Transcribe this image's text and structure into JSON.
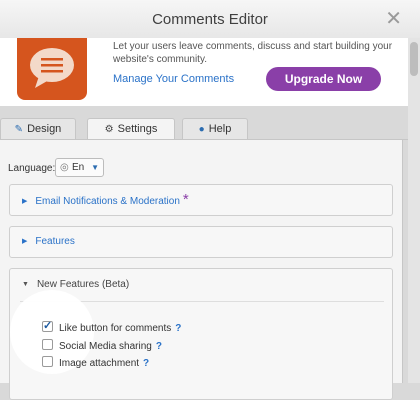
{
  "header": {
    "title": "Comments Editor",
    "close_glyph": "✕"
  },
  "promo": {
    "description": "Let your users leave comments, discuss and start building your website's community.",
    "manage_link": "Manage Your Comments",
    "upgrade_button": "Upgrade Now",
    "app_icon_color": "#d5551e",
    "upgrade_color": "#8a3fa8"
  },
  "tabs": [
    {
      "label": "Design",
      "icon": "paint-brush-icon",
      "glyph": "✎"
    },
    {
      "label": "Settings",
      "icon": "gear-icon",
      "glyph": "⚙",
      "active": true
    },
    {
      "label": "Help",
      "icon": "user-icon",
      "glyph": "●"
    }
  ],
  "settings": {
    "language_label": "Language:",
    "language_value": "En",
    "panels": {
      "email": {
        "label": "Email Notifications & Moderation",
        "star": "*"
      },
      "features": {
        "label": "Features"
      },
      "beta": {
        "label": "New Features (Beta)",
        "options": [
          {
            "label": "Like button for comments",
            "checked": true,
            "help": "?"
          },
          {
            "label": "Social Media sharing",
            "checked": false,
            "help": "?"
          },
          {
            "label": "Image attachment",
            "checked": false,
            "help": "?"
          }
        ]
      }
    }
  },
  "colors": {
    "link": "#2a72c8",
    "accent_purple": "#8a3fa8"
  }
}
